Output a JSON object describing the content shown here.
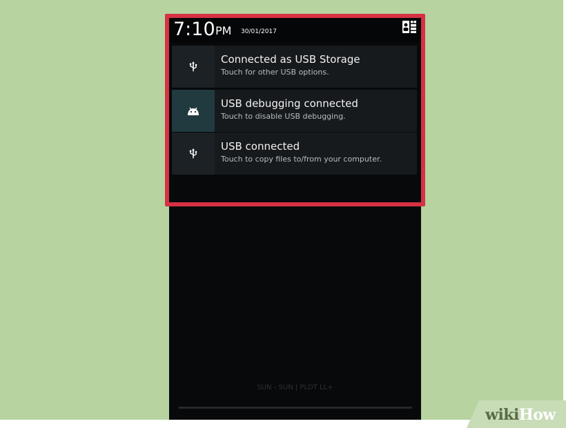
{
  "status_bar": {
    "time": "7:10",
    "ampm": "PM",
    "date": "30/01/2017",
    "quick_settings_icon": "quick-settings-icon"
  },
  "notifications": [
    {
      "icon": "usb-icon",
      "title": "Connected as USB Storage",
      "subtitle": "Touch for other USB options."
    },
    {
      "icon": "android-debug-icon",
      "title": "USB debugging connected",
      "subtitle": "Touch to disable USB debugging."
    },
    {
      "icon": "usb-icon",
      "title": "USB connected",
      "subtitle": "Touch to copy files to/from your computer."
    }
  ],
  "carrier_text": "SUN - SUN | PLDT LL+",
  "highlight_color": "#d63144",
  "background_color": "#b6d3a0",
  "watermark": {
    "part1": "wiki",
    "part2": "How"
  }
}
